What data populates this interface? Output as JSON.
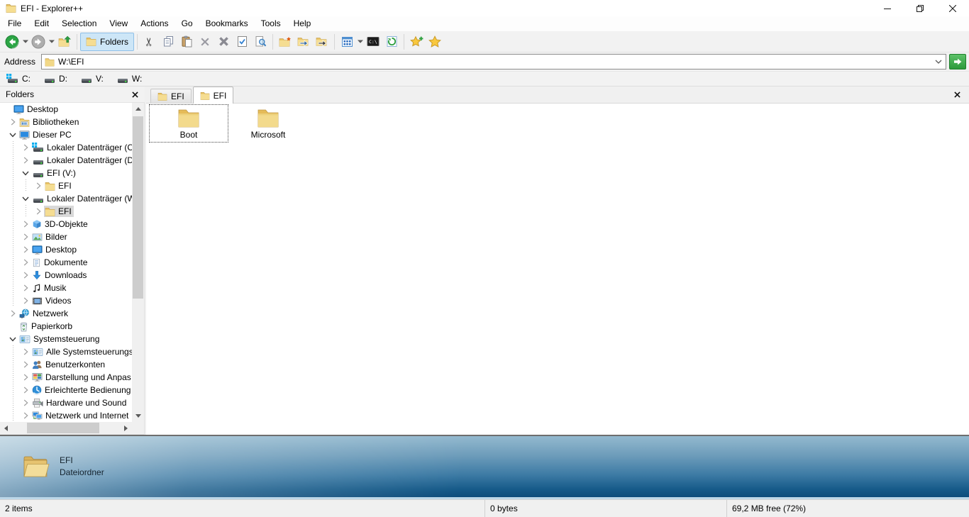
{
  "window": {
    "title": "EFI - Explorer++"
  },
  "window_controls": {
    "minimize": "minimize",
    "restore": "restore",
    "close": "close"
  },
  "menu": [
    "File",
    "Edit",
    "Selection",
    "View",
    "Actions",
    "Go",
    "Bookmarks",
    "Tools",
    "Help"
  ],
  "toolbar": {
    "buttons": [
      {
        "type": "button",
        "name": "back",
        "icon": "back",
        "dropdown": true
      },
      {
        "type": "button",
        "name": "forward",
        "icon": "forward",
        "dropdown": true
      },
      {
        "type": "button",
        "name": "up",
        "icon": "up"
      },
      {
        "type": "separator"
      },
      {
        "type": "button",
        "name": "folders-toggle",
        "icon": "folder",
        "label": "Folders",
        "active": true
      },
      {
        "type": "separator"
      },
      {
        "type": "button",
        "name": "cut",
        "icon": "cut"
      },
      {
        "type": "button",
        "name": "copy",
        "icon": "copy"
      },
      {
        "type": "button",
        "name": "paste",
        "icon": "paste"
      },
      {
        "type": "button",
        "name": "delete",
        "icon": "delete"
      },
      {
        "type": "button",
        "name": "delete-permanently",
        "icon": "delete-perm"
      },
      {
        "type": "button",
        "name": "properties",
        "icon": "properties"
      },
      {
        "type": "button",
        "name": "search",
        "icon": "search"
      },
      {
        "type": "separator"
      },
      {
        "type": "button",
        "name": "new-folder",
        "icon": "new-folder"
      },
      {
        "type": "button",
        "name": "copy-to",
        "icon": "copy-to"
      },
      {
        "type": "button",
        "name": "move-to",
        "icon": "move-to"
      },
      {
        "type": "separator"
      },
      {
        "type": "button",
        "name": "views",
        "icon": "views",
        "dropdown": true
      },
      {
        "type": "button",
        "name": "command-prompt",
        "icon": "cmd"
      },
      {
        "type": "button",
        "name": "refresh",
        "icon": "refresh"
      },
      {
        "type": "separator"
      },
      {
        "type": "button",
        "name": "add-bookmark",
        "icon": "star-add"
      },
      {
        "type": "button",
        "name": "bookmarks",
        "icon": "star"
      }
    ]
  },
  "address": {
    "label": "Address",
    "value": "W:\\EFI"
  },
  "drives": [
    {
      "label": "C:",
      "icon": "drive-windows"
    },
    {
      "label": "D:",
      "icon": "drive"
    },
    {
      "label": "V:",
      "icon": "drive"
    },
    {
      "label": "W:",
      "icon": "drive"
    }
  ],
  "folders_panel": {
    "title": "Folders"
  },
  "tree": [
    {
      "label": "Desktop",
      "level": 0,
      "chevron": "none",
      "icon": "desktop"
    },
    {
      "label": "Bibliotheken",
      "level": 1,
      "chevron": "collapsed",
      "icon": "library"
    },
    {
      "label": "Dieser PC",
      "level": 1,
      "chevron": "expanded",
      "icon": "computer"
    },
    {
      "label": "Lokaler Datenträger (C:",
      "level": 2,
      "chevron": "collapsed",
      "icon": "drive-windows"
    },
    {
      "label": "Lokaler Datenträger (D:",
      "level": 2,
      "chevron": "collapsed",
      "icon": "drive"
    },
    {
      "label": "EFI (V:)",
      "level": 2,
      "chevron": "expanded",
      "icon": "drive"
    },
    {
      "label": "EFI",
      "level": 3,
      "chevron": "collapsed",
      "icon": "folder"
    },
    {
      "label": "Lokaler Datenträger (W",
      "level": 2,
      "chevron": "expanded",
      "icon": "drive"
    },
    {
      "label": "EFI",
      "level": 3,
      "chevron": "collapsed",
      "icon": "folder",
      "selected": true
    },
    {
      "label": "3D-Objekte",
      "level": 2,
      "chevron": "collapsed",
      "icon": "cube"
    },
    {
      "label": "Bilder",
      "level": 2,
      "chevron": "collapsed",
      "icon": "pictures"
    },
    {
      "label": "Desktop",
      "level": 2,
      "chevron": "collapsed",
      "icon": "desktop"
    },
    {
      "label": "Dokumente",
      "level": 2,
      "chevron": "collapsed",
      "icon": "documents"
    },
    {
      "label": "Downloads",
      "level": 2,
      "chevron": "collapsed",
      "icon": "downloads"
    },
    {
      "label": "Musik",
      "level": 2,
      "chevron": "collapsed",
      "icon": "music"
    },
    {
      "label": "Videos",
      "level": 2,
      "chevron": "collapsed",
      "icon": "videos"
    },
    {
      "label": "Netzwerk",
      "level": 1,
      "chevron": "collapsed",
      "icon": "network"
    },
    {
      "label": "Papierkorb",
      "level": 1,
      "chevron": "none",
      "icon": "recycle"
    },
    {
      "label": "Systemsteuerung",
      "level": 1,
      "chevron": "expanded",
      "icon": "controlpanel"
    },
    {
      "label": "Alle Systemsteuerungs",
      "level": 2,
      "chevron": "collapsed",
      "icon": "controlpanel"
    },
    {
      "label": "Benutzerkonten",
      "level": 2,
      "chevron": "collapsed",
      "icon": "users"
    },
    {
      "label": "Darstellung und Anpas",
      "level": 2,
      "chevron": "collapsed",
      "icon": "personalization"
    },
    {
      "label": "Erleichterte Bedienung",
      "level": 2,
      "chevron": "collapsed",
      "icon": "accessibility"
    },
    {
      "label": "Hardware und Sound",
      "level": 2,
      "chevron": "collapsed",
      "icon": "hardware"
    },
    {
      "label": "Netzwerk und Internet",
      "level": 2,
      "chevron": "collapsed",
      "icon": "network2"
    }
  ],
  "tabs": [
    {
      "label": "EFI",
      "active": false
    },
    {
      "label": "EFI",
      "active": true
    }
  ],
  "files": [
    {
      "name": "Boot",
      "focused": true
    },
    {
      "name": "Microsoft",
      "focused": false
    }
  ],
  "display": {
    "name": "EFI",
    "type": "Dateiordner"
  },
  "status": {
    "items": "2 items",
    "size": "0 bytes",
    "free": "69,2 MB free (72%)"
  },
  "colors": {
    "selection": "#cde6f7",
    "tree_selection": "#d9d9d9",
    "pane_top": "#93b9cf",
    "pane_bottom": "#0d4c7b",
    "folder": "#f5dd92",
    "go_button": "#2d9a3c"
  }
}
